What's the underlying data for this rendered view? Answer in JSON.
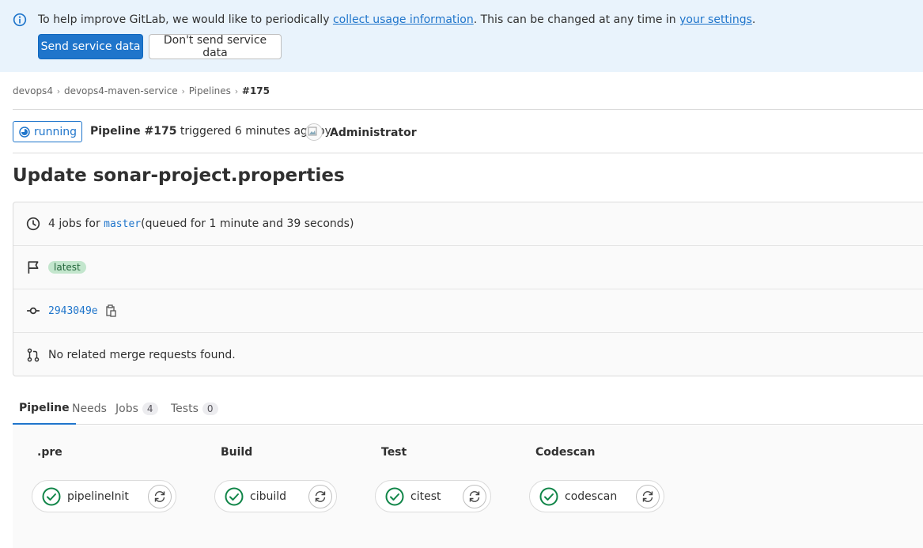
{
  "banner": {
    "text_before": "To help improve GitLab, we would like to periodically ",
    "link1": "collect usage information",
    "text_middle": ". This can be changed at any time in ",
    "link2": "your settings",
    "text_after": ".",
    "send_button": "Send service data",
    "dont_send_button": "Don't send service data"
  },
  "breadcrumb": {
    "items": [
      "devops4",
      "devops4-maven-service",
      "Pipelines",
      "#175"
    ]
  },
  "header": {
    "status": "running",
    "pipeline_label": "Pipeline #175",
    "triggered_text": " triggered 6 minutes ago by",
    "user": "Administrator"
  },
  "title": "Update sonar-project.properties",
  "info": {
    "jobs_prefix": "4 jobs for ",
    "branch": "master",
    "jobs_suffix": " (queued for 1 minute and 39 seconds)",
    "tag": "latest",
    "commit": "2943049e",
    "merge_requests": "No related merge requests found."
  },
  "tabs": [
    {
      "label": "Pipeline",
      "count": null
    },
    {
      "label": "Needs",
      "count": null
    },
    {
      "label": "Jobs",
      "count": "4"
    },
    {
      "label": "Tests",
      "count": "0"
    }
  ],
  "stages": [
    {
      "title": ".pre",
      "job": "pipelineInit"
    },
    {
      "title": "Build",
      "job": "cibuild"
    },
    {
      "title": "Test",
      "job": "citest"
    },
    {
      "title": "Codescan",
      "job": "codescan"
    }
  ],
  "colors": {
    "primary": "#1f75cb",
    "success": "#108548",
    "banner_bg": "#e9f3fc"
  }
}
